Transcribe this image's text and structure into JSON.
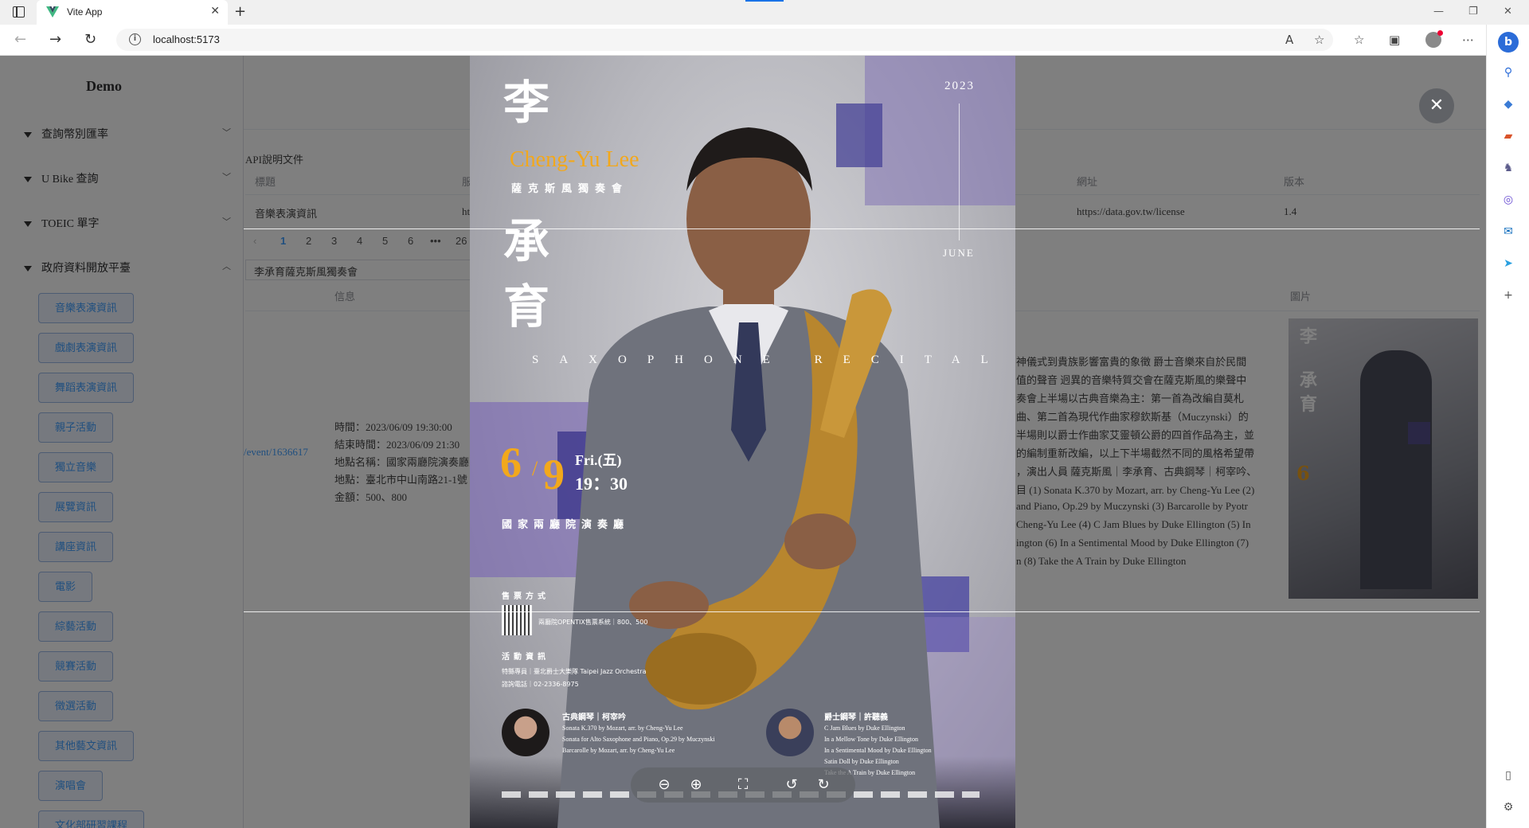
{
  "browser": {
    "tab_title": "Vite App",
    "url": "localhost:5173",
    "colors": {
      "vite_favicon": "#41b883",
      "accent": "#409eff"
    }
  },
  "sidebar": {
    "brand": "Demo",
    "groups": [
      {
        "label": "查詢幣別匯率",
        "expanded": false
      },
      {
        "label": "U Bike 查詢",
        "expanded": false
      },
      {
        "label": "TOEIC 單字",
        "expanded": false
      },
      {
        "label": "政府資料開放平臺",
        "expanded": true
      }
    ],
    "items": [
      "音樂表演資訊",
      "戲劇表演資訊",
      "舞蹈表演資訊",
      "親子活動",
      "獨立音樂",
      "展覽資訊",
      "講座資訊",
      "電影",
      "綜藝活動",
      "競賽活動",
      "徵選活動",
      "其他藝文資訊",
      "演唱會",
      "文化部研習課程"
    ]
  },
  "main": {
    "section_title": "API說明文件",
    "table_headers": [
      "標題",
      "服",
      "網址",
      "版本"
    ],
    "row": {
      "title": "音樂表演資訊",
      "service_prefix": "ht",
      "url": "https://data.gov.tw/license",
      "version": "1.4"
    },
    "pager": [
      "1",
      "2",
      "3",
      "4",
      "5",
      "6",
      "•••",
      "26"
    ],
    "selected_event": "李承育薩克斯風獨奏會",
    "event_headers": {
      "info": "信息",
      "image": "圖片"
    },
    "event_link": "/event/1636617",
    "event_info": [
      "時間：2023/06/09 19:30:00",
      "結束時間：2023/06/09 21:30",
      "地點名稱：國家兩廳院演奏廳",
      "地點：臺北市中山南路21-1號",
      "金額：500、800"
    ],
    "description": [
      "神儀式到貴族影響富貴的象徵 爵士音樂來自於民間",
      "值的聲音 迥異的音樂特質交會在薩克斯風的樂聲中",
      "奏會上半場以古典音樂為主：第一首為改編自莫札",
      "曲、第二首為現代作曲家穆欽斯基（Muczynski）的",
      "半場則以爵士作曲家艾靈頓公爵的四首作品為主，並",
      "的編制重新改編，以上下半場截然不同的風格希望帶",
      "，演出人員 薩克斯風｜李承育、古典鋼琴｜柯宰吟、",
      "目 (1) Sonata K.370 by Mozart, arr. by Cheng-Yu Lee (2)",
      "and Piano, Op.29 by Muczynski (3) Barcarolle by Pyotr",
      "Cheng-Yu Lee (4) C Jam Blues by Duke Ellington (5) In",
      "ington (6) In a Sentimental Mood by Duke Ellington (7)",
      "n (8) Take the A Train by Duke Ellington"
    ]
  },
  "poster": {
    "name_cn": [
      "李",
      "承",
      "育"
    ],
    "name_en": "Cheng-Yu Lee",
    "subtitle": "薩克斯風獨奏會",
    "year": "2023",
    "month": "JUNE",
    "recital": "SAXOPHONE RECITAL",
    "date_month": "6",
    "date_slash": "/",
    "date_day": "9",
    "weekday": "Fri.(五)",
    "time": "19：30",
    "venue": "國家兩廳院演奏廳",
    "ticket_heading": "售票方式",
    "ticket_line": "兩廳院OPENTIX售票系統｜800、500",
    "info_heading": "活動資訊",
    "info_lines": [
      "特縣專員｜臺北爵士大樂隊 Taipei Jazz Orchestra",
      "諮詢電話｜02-2336-8975"
    ],
    "left_performer": "古典鋼琴｜柯宰吟",
    "left_program": [
      "Sonata K.370 by Mozart, arr. by Cheng-Yu Lee",
      "Sonata for Alto Saxophone and Piano, Op.29 by Muczynski",
      "Barcarolle by Mozart, arr. by Cheng-Yu Lee"
    ],
    "right_performer": "爵士鋼琴｜許聽義",
    "right_program": [
      "C Jam Blues by Duke Ellington",
      "In a Mellow Tone by Duke Ellington",
      "In a Sentimental Mood by Duke Ellington",
      "Satin Doll by Duke Ellington",
      "Take the A Train by Duke Ellington"
    ]
  },
  "viewer_actions": [
    "zoom-out-icon",
    "zoom-in-icon",
    "fit-icon",
    "rotate-left-icon",
    "rotate-right-icon"
  ]
}
